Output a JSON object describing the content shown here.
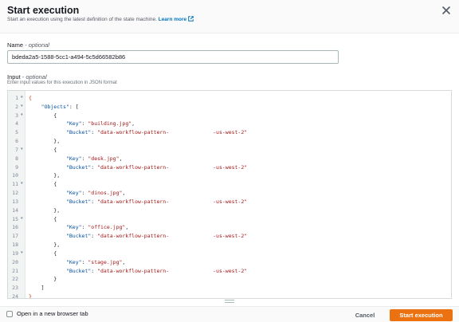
{
  "modal": {
    "title": "Start execution",
    "subtitle": "Start an execution using the latest definition of the state machine.",
    "learn_more": "Learn more",
    "close_icon": "close-icon",
    "external_icon": "external-link-icon"
  },
  "name_field": {
    "label": "Name",
    "optional": "- optional",
    "value": "bdeda2a5-1588-5cc1-a494-5c5d66582b86"
  },
  "input_field": {
    "label": "Input",
    "optional": "- optional",
    "description": "Enter input values for this execution in JSON format"
  },
  "editor": {
    "lines": [
      {
        "n": "1",
        "fold": true
      },
      {
        "n": "2",
        "fold": true
      },
      {
        "n": "3",
        "fold": true
      },
      {
        "n": "4",
        "fold": false
      },
      {
        "n": "5",
        "fold": false
      },
      {
        "n": "6",
        "fold": false
      },
      {
        "n": "7",
        "fold": true
      },
      {
        "n": "8",
        "fold": false
      },
      {
        "n": "9",
        "fold": false
      },
      {
        "n": "10",
        "fold": false
      },
      {
        "n": "11",
        "fold": true
      },
      {
        "n": "12",
        "fold": false
      },
      {
        "n": "13",
        "fold": false
      },
      {
        "n": "14",
        "fold": false
      },
      {
        "n": "15",
        "fold": true
      },
      {
        "n": "16",
        "fold": false
      },
      {
        "n": "17",
        "fold": false
      },
      {
        "n": "18",
        "fold": false
      },
      {
        "n": "19",
        "fold": true
      },
      {
        "n": "20",
        "fold": false
      },
      {
        "n": "21",
        "fold": false
      },
      {
        "n": "22",
        "fold": false
      },
      {
        "n": "23",
        "fold": false
      },
      {
        "n": "24",
        "fold": false
      }
    ],
    "objects_key": "\"Objects\"",
    "key_label": "\"Key\"",
    "bucket_label": "\"Bucket\"",
    "bucket_prefix": "\"data-workflow-pattern-",
    "bucket_suffix": "-us-west-2\"",
    "files": [
      "\"building.jpg\"",
      "\"desk.jpg\"",
      "\"dinos.jpg\"",
      "\"office.jpg\"",
      "\"stage.jpg\""
    ]
  },
  "footer": {
    "checkbox_label": "Open in a new browser tab",
    "cancel": "Cancel",
    "start": "Start execution"
  },
  "colors": {
    "accent": "#ec7211",
    "link": "#0073bb"
  }
}
